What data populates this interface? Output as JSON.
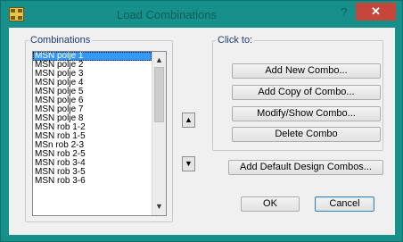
{
  "window": {
    "title": "Load Combinations",
    "help_label": "?",
    "close_label": "✕"
  },
  "combinations": {
    "label": "Combinations",
    "items": [
      "MSN polje 1",
      "MSN polje 2",
      "MSN polje 3",
      "MSN polje 4",
      "MSN polje 5",
      "MSN polje 6",
      "MSN polje 7",
      "MSN polje 8",
      "MSN rob 1-2",
      "MSN rob 1-5",
      "MSn rob 2-3",
      "MSN rob 2-5",
      "MSN rob 3-4",
      "MSN rob 3-5",
      "MSN rob 3-6"
    ],
    "selected_index": 0,
    "scroll_up_glyph": "▲",
    "scroll_down_glyph": "▼"
  },
  "move": {
    "up_glyph": "▲",
    "down_glyph": "▼"
  },
  "click_to": {
    "label": "Click to:",
    "add_new": "Add New Combo...",
    "add_copy": "Add Copy of Combo...",
    "modify_show": "Modify/Show Combo...",
    "delete": "Delete Combo"
  },
  "add_default": "Add Default Design Combos...",
  "ok": "OK",
  "cancel": "Cancel",
  "colors": {
    "title_bar": "#17908b",
    "close_button": "#c7463a",
    "selection": "#3399ff",
    "group_label": "#1f3a7a"
  }
}
